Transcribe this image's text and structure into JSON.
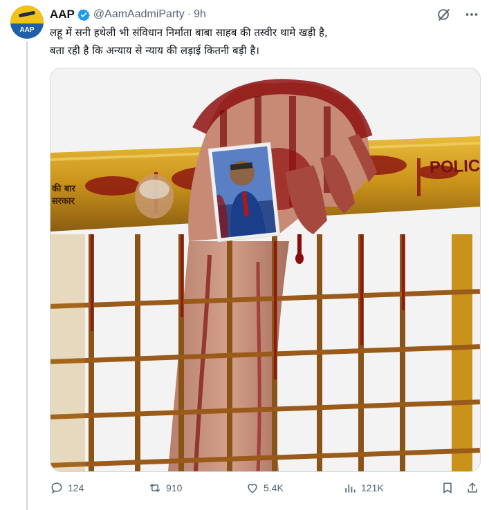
{
  "post": {
    "author_name": "AAP",
    "author_handle": "@AamAadmiParty",
    "separator": "·",
    "time_ago": "9h",
    "avatar_text": "AAP",
    "text_lines": [
      "लहू में सनी हथेली भी संविधान निर्माता बाबा साहब की तस्वीर थामे खड़ी है,",
      "बता रही है कि अन्याय से न्याय की लड़ाई कितनी बड़ी है।"
    ],
    "image_signage": {
      "left_line1": "की बार",
      "left_line2": "सरकार",
      "right": "POLIC"
    }
  },
  "actions": {
    "replies": "124",
    "reposts": "910",
    "likes": "5.4K",
    "views": "121K"
  },
  "colors": {
    "accent": "#1d9bf0",
    "muted": "#536471",
    "border": "#cfd9de",
    "rail_yellow": "#d9a521",
    "blood_red": "#8f1010"
  },
  "icons": [
    "verified-badge-icon",
    "grok-icon",
    "more-icon",
    "reply-icon",
    "repost-icon",
    "like-icon",
    "views-icon",
    "bookmark-icon",
    "share-icon"
  ]
}
